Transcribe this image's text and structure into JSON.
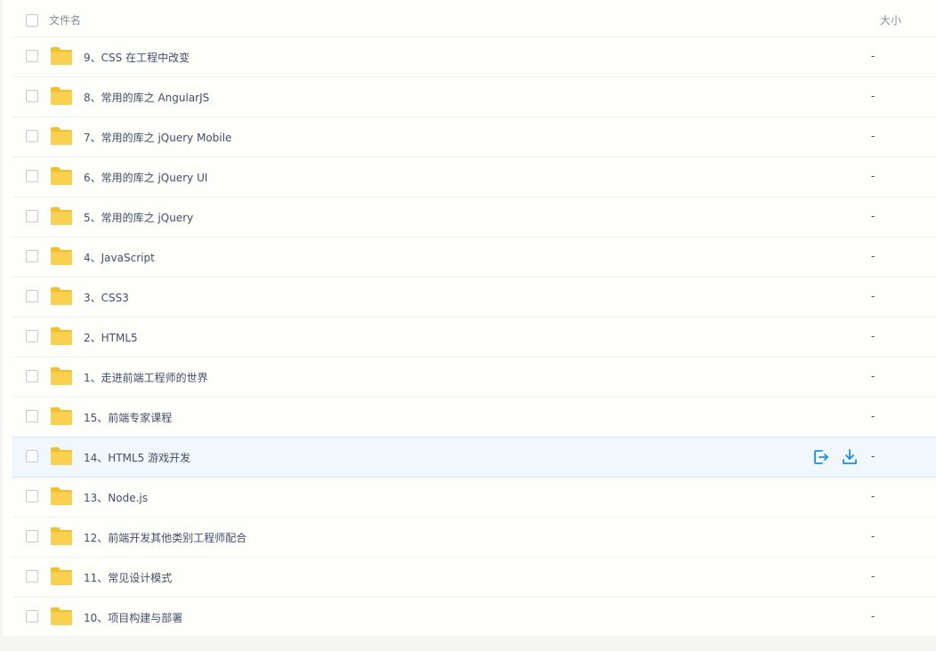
{
  "header": {
    "name_label": "文件名",
    "size_label": "大小"
  },
  "colors": {
    "folder": "#f9d04f",
    "folder_dark": "#f3bd2b",
    "accent": "#1a8ee1"
  },
  "hovered_index": 10,
  "rows": [
    {
      "name": "9、CSS 在工程中改变",
      "size": "-"
    },
    {
      "name": "8、常用的库之 AngularJS",
      "size": "-"
    },
    {
      "name": "7、常用的库之 jQuery Mobile",
      "size": "-"
    },
    {
      "name": "6、常用的库之 jQuery UI",
      "size": "-"
    },
    {
      "name": "5、常用的库之 jQuery",
      "size": "-"
    },
    {
      "name": "4、JavaScript",
      "size": "-"
    },
    {
      "name": "3、CSS3",
      "size": "-"
    },
    {
      "name": "2、HTML5",
      "size": "-"
    },
    {
      "name": "1、走进前端工程师的世界",
      "size": "-"
    },
    {
      "name": "15、前端专家课程",
      "size": "-"
    },
    {
      "name": "14、HTML5 游戏开发",
      "size": "-"
    },
    {
      "name": "13、Node.js",
      "size": "-"
    },
    {
      "name": "12、前端开发其他类别工程师配合",
      "size": "-"
    },
    {
      "name": "11、常见设计模式",
      "size": "-"
    },
    {
      "name": "10、项目构建与部署",
      "size": "-"
    }
  ],
  "row_actions": [
    {
      "icon": "share-icon"
    },
    {
      "icon": "download-icon"
    }
  ]
}
